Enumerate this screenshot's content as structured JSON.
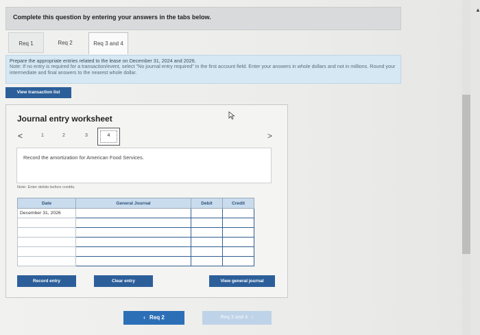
{
  "header": {
    "title": "Complete this question by entering your answers in the tabs below."
  },
  "tabs": [
    {
      "label": "Req 1"
    },
    {
      "label": "Req 2"
    },
    {
      "label": "Req 3 and 4"
    }
  ],
  "instructions": {
    "line1": "Prepare the appropriate entries related to the lease on December 31, 2024 and 2026.",
    "line2": "Note: If no entry is required for a transaction/event, select \"No journal entry required\" in the first account field. Enter your answers in whole dollars and not in millions. Round your intermediate and final answers to the nearest whole dollar."
  },
  "buttons": {
    "view_transaction_list": "View transaction list",
    "record_entry": "Record entry",
    "clear_entry": "Clear entry",
    "view_general_journal": "View general journal",
    "prev": "Req 2",
    "next": "Req 3 and 4"
  },
  "worksheet": {
    "title": "Journal entry worksheet",
    "pages": [
      "1",
      "2",
      "3",
      "4"
    ],
    "active_page": "4",
    "task": "Record the amortization for American Food Services.",
    "note": "Note: Enter debits before credits.",
    "columns": [
      "Date",
      "General Journal",
      "Debit",
      "Credit"
    ],
    "date": "December 31, 2026"
  },
  "icons": {
    "prev_arrow": "‹",
    "next_arrow": "›",
    "pager_left": "<",
    "pager_right": ">"
  }
}
